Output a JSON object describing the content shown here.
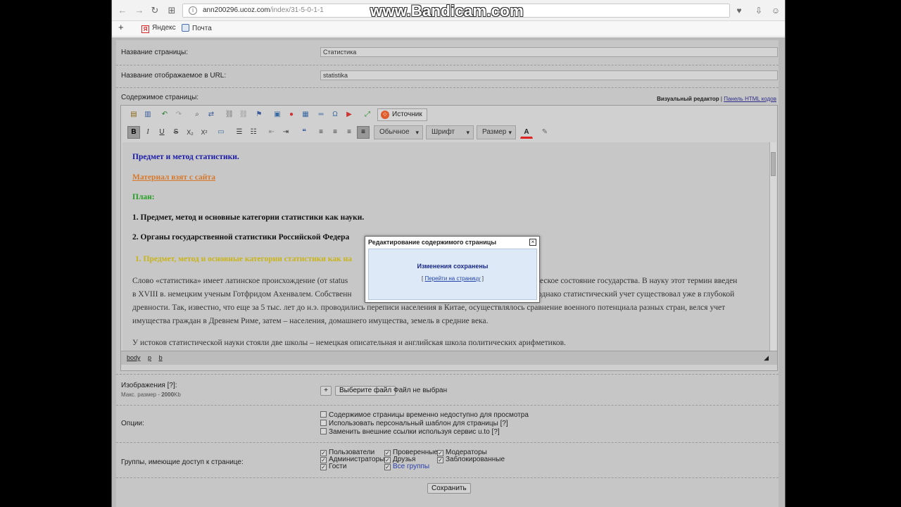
{
  "browser": {
    "url_host": "ann200296.ucoz.com",
    "url_path": "/index/31-5-0-1-1",
    "watermark": "www.Bandicam.com",
    "bookmarks": [
      {
        "label": "Яндекс"
      },
      {
        "label": "Почта"
      }
    ]
  },
  "form": {
    "page_name_label": "Название страницы:",
    "page_name_value": "Статистика",
    "url_name_label": "Название отображаемое в URL:",
    "url_name_value": "statistika",
    "content_label": "Содержимое страницы:",
    "visual_editor_label": "Визуальный редактор",
    "html_panel_label": "Панель HTML кодов",
    "separator": "|"
  },
  "toolbar": {
    "source_label": "Источник",
    "format_dropdown": "Обычное",
    "font_dropdown": "Шрифт",
    "size_dropdown": "Размер",
    "bold": "B",
    "italic": "I",
    "underline": "U",
    "strike": "S",
    "sub": "X₂",
    "sup": "X²",
    "text_color": "A"
  },
  "editor_content": {
    "title": "Предмет и метод статистики.",
    "source_link": "Материал взят с сайта",
    "plan": "План:",
    "item1": "1. Предмет, метод и основные категории статистики как науки.",
    "item2": "2. Органы государственной статистики Российской Федера",
    "heading1": "1. Предмет, метод и основные категории статистики как на",
    "para1_l1a": "Слово «статистика» имеет латинское происхождение (от status",
    "para1_l1b": "тическое состояние государства. В науку этот термин введен",
    "para1_l2a": "в XVIII в. немецким ученым Готфридом Ахенвалем. Собственн",
    "para1_l2b": "в., однако статистический учет существовал уже в глубокой",
    "para1_l3": "древности. Так, известно, что еще за 5 тыс. лет до н.э. проводились переписи населения в Китае, осуществлялось сравнение военного потенциала разных стран, велся учет",
    "para1_l4": "имущества граждан в Древнем Риме, затем – населения, домашнего имущества, земель в средние века.",
    "para2": "У истоков статистической науки стояли две школы – немецкая описательная и английская школа политических арифметиков."
  },
  "path_bar": [
    "body",
    "p",
    "b"
  ],
  "images": {
    "label": "Изображения [?]:",
    "max_size_label": "Макс. размер -",
    "max_size_value": "2000",
    "max_size_unit": "Kb",
    "add_button": "+",
    "choose_button": "Выберите файл",
    "no_file": "Файл не выбран"
  },
  "options": {
    "label": "Опции:",
    "items": [
      {
        "label": "Содержимое страницы временно недоступно для просмотра",
        "checked": false
      },
      {
        "label": "Использовать персональный шаблон для страницы",
        "help": "[?]",
        "checked": false
      },
      {
        "label": "Заменить внешние ссылки используя сервис u.to",
        "help": "[?]",
        "checked": false
      }
    ]
  },
  "groups": {
    "label": "Группы, имеющие доступ к странице:",
    "col1": [
      "Пользователи",
      "Администраторы",
      "Гости"
    ],
    "col2": [
      "Проверенные",
      "Друзья",
      "Все группы"
    ],
    "col3": [
      "Модераторы",
      "Заблокированные"
    ]
  },
  "save_button": "Сохранить",
  "modal": {
    "title": "Редактирование содержимого страницы",
    "close": "×",
    "message": "Изменения сохранены",
    "link_open": "[",
    "link_text": "Перейти на страницу",
    "link_close": "]"
  }
}
